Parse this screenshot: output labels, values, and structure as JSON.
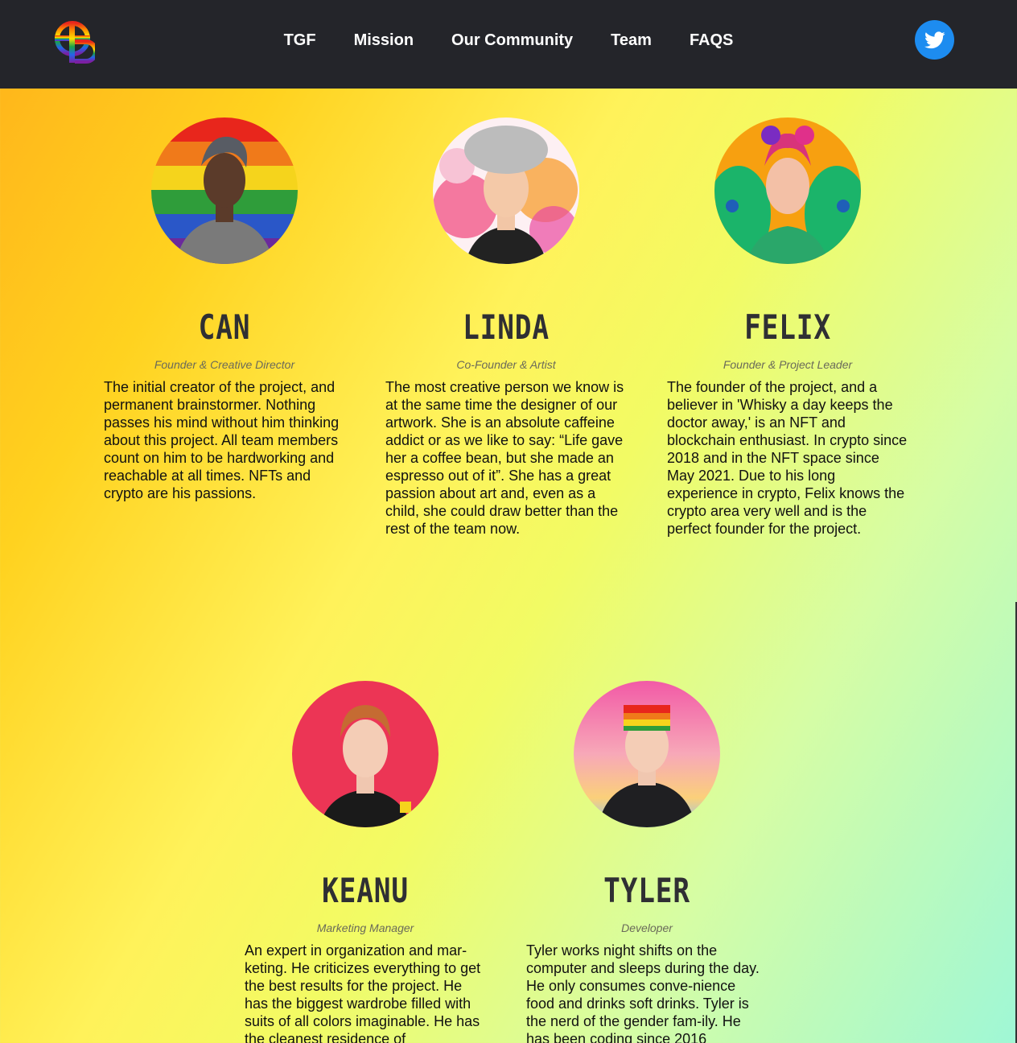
{
  "nav": {
    "items": [
      {
        "label": "TGF"
      },
      {
        "label": "Mission"
      },
      {
        "label": "Our Community"
      },
      {
        "label": "Team"
      },
      {
        "label": "FAQS"
      }
    ],
    "social_icon": "twitter-icon",
    "logo_icon": "tgf-rainbow-logo"
  },
  "team": [
    {
      "name": "CAN",
      "role": "Founder & Creative Director",
      "bio": "The initial creator of the project, and permanent brainstormer. Nothing passes his mind without him thinking about this project. All team members count on him to be hardworking and reachable at all times. NFTs and crypto are his passions.",
      "avatar_bg": "rainbow-flag"
    },
    {
      "name": "LINDA",
      "role": "Co-Founder & Artist",
      "bio": "The most creative person we know is at the same time the designer of our artwork. She is an absolute caffeine addict or as we like to say: “Life gave her a coffee bean, but she made an espresso out of it”. She has a great passion about art and, even as a child, she could draw better than the rest of the team now.",
      "avatar_bg": "paint-splash"
    },
    {
      "name": "FELIX",
      "role": "Founder & Project Leader",
      "bio": "The founder of the project, and a believer in 'Whisky a day keeps the doctor away,' is an NFT and blockchain enthusiast. In crypto since 2018 and in the NFT space since May 2021. Due to his long experience in crypto, Felix knows the crypto area very well and is the perfect founder for the project.",
      "avatar_bg": "peacock"
    },
    {
      "name": "KEANU",
      "role": "Marketing Manager",
      "bio": "An expert in organization and mar-keting. He criticizes everything to get the best results for the project. He has the biggest wardrobe filled with suits of all colors imaginable. He has the cleanest residence of",
      "avatar_bg": "red"
    },
    {
      "name": "TYLER",
      "role": "Developer",
      "bio": "Tyler works night shifts on the computer and sleeps during the day. He only consumes conve-nience food and drinks soft drinks. Tyler is the nerd of the gender fam-ily. He has been coding since 2016",
      "avatar_bg": "sunset"
    }
  ]
}
